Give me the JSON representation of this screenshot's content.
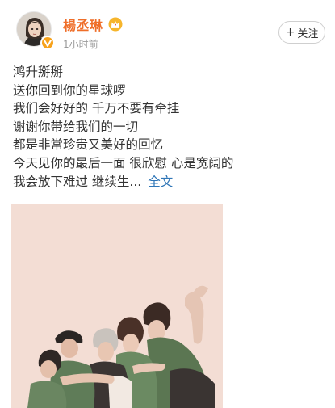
{
  "post": {
    "author": {
      "name": "楊丞琳",
      "avatar_icon": "avatar-photo",
      "verified_icon": "verified-badge-icon",
      "vip_icon": "crown-icon",
      "name_color": "#ef6e29",
      "verified_color": "#f7a21b"
    },
    "timestamp": "1小时前",
    "follow_button": {
      "plus": "+",
      "label": "关注"
    },
    "lines": [
      "鸿升掰掰",
      "送你回到你的星球啰",
      "我们会好好的 千万不要有牵挂",
      "谢谢你带给我们的一切",
      "都是非常珍贵又美好的回忆",
      "今天见你的最后一面 很欣慰 心是宽阔的",
      "我会放下难过 继续生..."
    ],
    "expand_link": "全文",
    "link_color": "#2f76b7",
    "image": {
      "subject": "illustration-group-of-friends",
      "background": "#f3ddd4"
    }
  }
}
